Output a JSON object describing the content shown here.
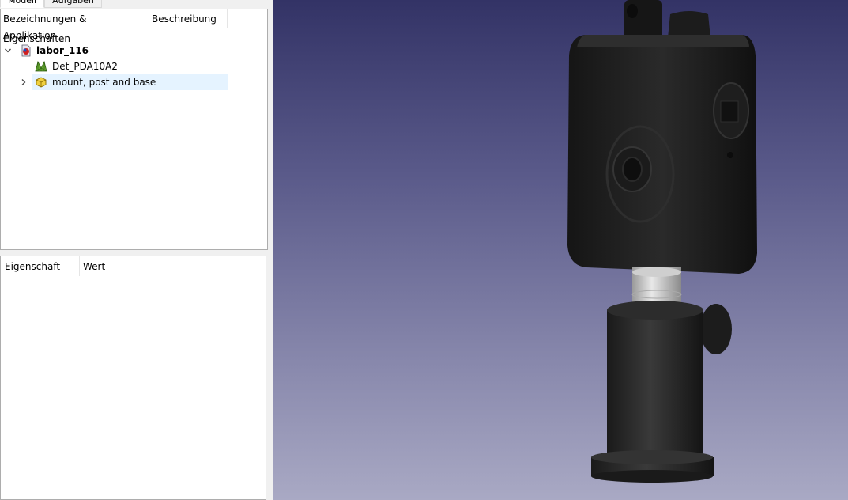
{
  "tabs": [
    {
      "label": "Modell",
      "active": true
    },
    {
      "label": "Aufgaben",
      "active": false
    }
  ],
  "tree": {
    "columns": [
      "Bezeichnungen & Eigenschaften",
      "Beschreibung"
    ],
    "root_label": "Applikation",
    "items": [
      {
        "label": "labor_116",
        "icon": "document-icon",
        "expanded": true,
        "bold": true
      },
      {
        "label": "Det_PDA10A2",
        "icon": "mesh-icon",
        "expanded": false
      },
      {
        "label": "mount, post and base",
        "icon": "part-icon",
        "expanded": false,
        "selected": true
      }
    ]
  },
  "properties": {
    "columns": [
      "Eigenschaft",
      "Wert"
    ]
  },
  "colors": {
    "viewport_top": "#333366",
    "viewport_bottom": "#a9a9c4",
    "selection": "#e5f3ff"
  }
}
